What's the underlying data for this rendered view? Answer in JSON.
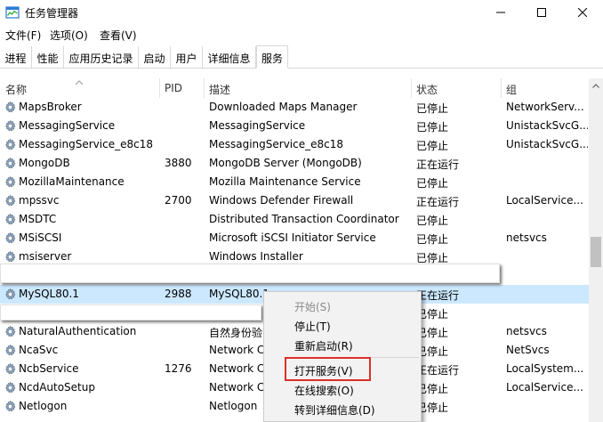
{
  "window": {
    "title": "任务管理器"
  },
  "menu": [
    {
      "label": "文件(F)"
    },
    {
      "label": "选项(O)"
    },
    {
      "label": "查看(V)"
    }
  ],
  "tabs": [
    {
      "label": "进程"
    },
    {
      "label": "性能"
    },
    {
      "label": "应用历史记录"
    },
    {
      "label": "启动"
    },
    {
      "label": "用户"
    },
    {
      "label": "详细信息"
    },
    {
      "label": "服务"
    }
  ],
  "columns": {
    "name": "名称",
    "pid": "PID",
    "desc": "描述",
    "status": "状态",
    "group": "组"
  },
  "services": [
    {
      "name": "MapsBroker",
      "pid": "",
      "desc": "Downloaded Maps Manager",
      "status": "已停止",
      "group": "NetworkServ..."
    },
    {
      "name": "MessagingService",
      "pid": "",
      "desc": "MessagingService",
      "status": "已停止",
      "group": "UnistackSvcG..."
    },
    {
      "name": "MessagingService_e8c18",
      "pid": "",
      "desc": "MessagingService_e8c18",
      "status": "已停止",
      "group": "UnistackSvcG..."
    },
    {
      "name": "MongoDB",
      "pid": "3880",
      "desc": "MongoDB Server (MongoDB)",
      "status": "正在运行",
      "group": ""
    },
    {
      "name": "MozillaMaintenance",
      "pid": "",
      "desc": "Mozilla Maintenance Service",
      "status": "已停止",
      "group": ""
    },
    {
      "name": "mpssvc",
      "pid": "2700",
      "desc": "Windows Defender Firewall",
      "status": "正在运行",
      "group": "LocalService..."
    },
    {
      "name": "MSDTC",
      "pid": "",
      "desc": "Distributed Transaction Coordinator",
      "status": "已停止",
      "group": ""
    },
    {
      "name": "MSiSCSI",
      "pid": "",
      "desc": "Microsoft iSCSI Initiator Service",
      "status": "已停止",
      "group": "netsvcs"
    },
    {
      "name": "msiserver",
      "pid": "",
      "desc": "Windows Installer",
      "status": "已停止",
      "group": ""
    },
    {
      "name": "",
      "pid": "",
      "desc": "",
      "status": "",
      "group": ""
    },
    {
      "name": "MySQL80.1",
      "pid": "2988",
      "desc": "MySQL80.1",
      "status": "正在运行",
      "group": ""
    },
    {
      "name": "",
      "pid": "",
      "desc": "",
      "status": "已停止",
      "group": ""
    },
    {
      "name": "NaturalAuthentication",
      "pid": "",
      "desc": "自然身份验",
      "status": "已停止",
      "group": "netsvcs"
    },
    {
      "name": "NcaSvc",
      "pid": "",
      "desc": "Network C",
      "status": "已停止",
      "group": "NetSvcs"
    },
    {
      "name": "NcbService",
      "pid": "1276",
      "desc": "Network C",
      "status": "正在运行",
      "group": "LocalSystem..."
    },
    {
      "name": "NcdAutoSetup",
      "pid": "",
      "desc": "Network C",
      "status": "已停止",
      "group": "LocalService..."
    },
    {
      "name": "Netlogon",
      "pid": "",
      "desc": "Netlogon",
      "status": "已停止",
      "group": ""
    }
  ],
  "context_menu": [
    {
      "label": "开始(S)",
      "disabled": true
    },
    {
      "label": "停止(T)"
    },
    {
      "label": "重新启动(R)"
    },
    {
      "label": "打开服务(V)"
    },
    {
      "label": "在线搜索(O)"
    },
    {
      "label": "转到详细信息(D)"
    }
  ],
  "colors": {
    "selected_row": "#cce8ff",
    "highlight_border": "#d9302a",
    "menu_bg": "#f2f2f2"
  }
}
